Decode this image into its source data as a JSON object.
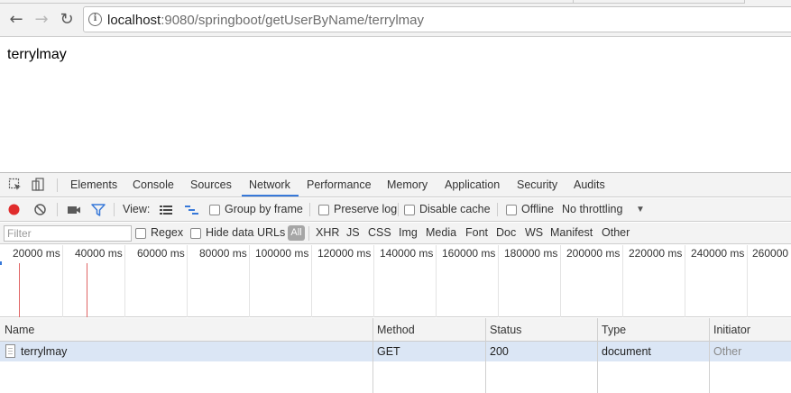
{
  "browser": {
    "url_host": "localhost",
    "url_rest": ":9080/springboot/getUserByName/terrylmay"
  },
  "page": {
    "body_text": "terrylmay"
  },
  "devtools": {
    "tabs": [
      "Elements",
      "Console",
      "Sources",
      "Network",
      "Performance",
      "Memory",
      "Application",
      "Security",
      "Audits"
    ],
    "active_tab": "Network",
    "toolbar": {
      "view_label": "View:",
      "group_by_frame": "Group by frame",
      "preserve_log": "Preserve log",
      "disable_cache": "Disable cache",
      "offline": "Offline",
      "throttling": "No throttling"
    },
    "filter": {
      "placeholder": "Filter",
      "regex": "Regex",
      "hide_data_urls": "Hide data URLs",
      "all": "All",
      "types": [
        "XHR",
        "JS",
        "CSS",
        "Img",
        "Media",
        "Font",
        "Doc",
        "WS",
        "Manifest",
        "Other"
      ]
    },
    "timeline_labels": [
      "20000 ms",
      "40000 ms",
      "60000 ms",
      "80000 ms",
      "100000 ms",
      "120000 ms",
      "140000 ms",
      "160000 ms",
      "180000 ms",
      "200000 ms",
      "220000 ms",
      "240000 ms",
      "260000"
    ],
    "columns": [
      "Name",
      "Method",
      "Status",
      "Type",
      "Initiator"
    ],
    "rows": [
      {
        "name": "terrylmay",
        "method": "GET",
        "status": "200",
        "type": "document",
        "initiator": "Other"
      }
    ],
    "colors": {
      "accent": "#3879d9",
      "record": "#e02c2c",
      "row_selected": "#dbe6f5"
    }
  }
}
